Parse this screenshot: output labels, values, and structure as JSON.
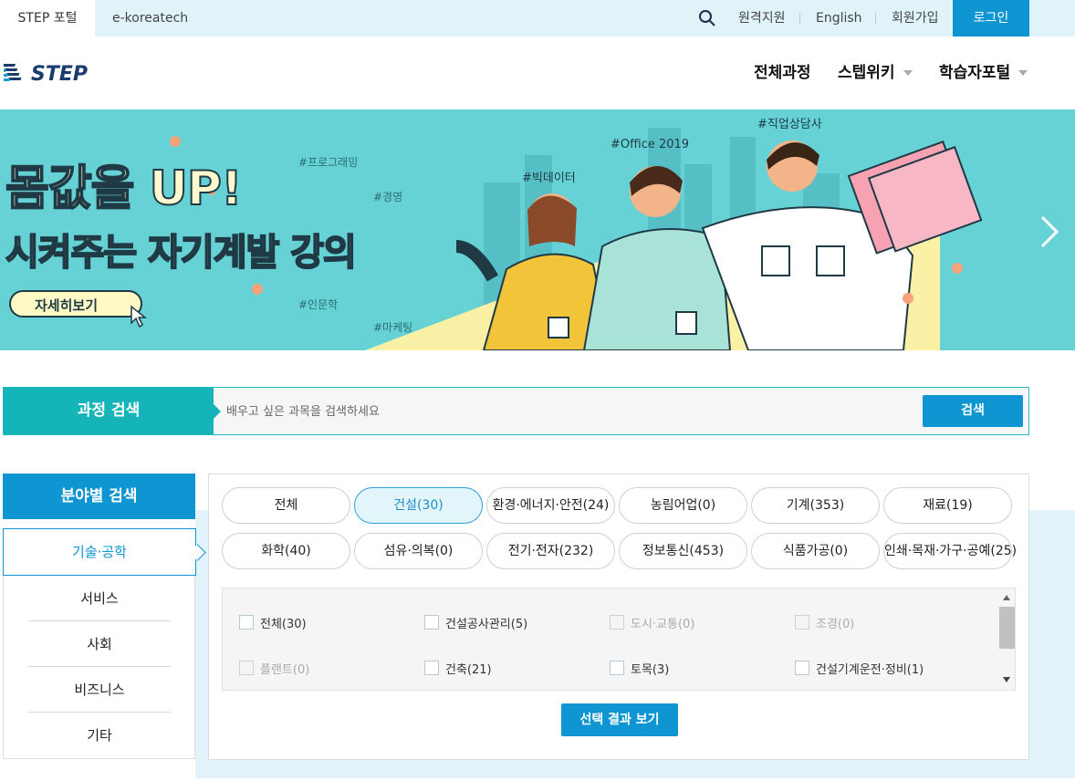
{
  "topbar": {
    "tabs": [
      "STEP 포털",
      "e-koreatech"
    ],
    "utils": [
      "원격지원",
      "English",
      "회원가입"
    ],
    "login": "로그인",
    "search_icon": "search-icon"
  },
  "header": {
    "logo_text": "STEP",
    "nav": [
      "전체과정",
      "스텝위키",
      "학습자포털"
    ]
  },
  "banner": {
    "title1": "몸값을 UP!",
    "title2": "시켜주는 자기계발 강의",
    "button": "자세히보기",
    "tags": [
      "#프로그래밍",
      "#경영",
      "#인문학",
      "#마케팅",
      "#빅데이터",
      "#Office 2019",
      "#직업상담사"
    ],
    "next_icon": "chevron-right-icon"
  },
  "course_search": {
    "label": "과정 검색",
    "placeholder": "배우고 싶은 과목을 검색하세요",
    "button": "검색"
  },
  "field_search": {
    "title": "분야별 검색",
    "categories": [
      "기술·공학",
      "서비스",
      "사회",
      "비즈니스",
      "기타"
    ],
    "active_category": "기술·공학",
    "chips": [
      "전체",
      "건설(30)",
      "환경·에너지·안전(24)",
      "농림어업(0)",
      "기계(353)",
      "재료(19)",
      "화학(40)",
      "섬유·의복(0)",
      "전기·전자(232)",
      "정보통신(453)",
      "식품가공(0)",
      "인쇄·목재·가구·공예(25)"
    ],
    "active_chip": "건설(30)",
    "subcategories": [
      {
        "label": "전체(30)",
        "disabled": false
      },
      {
        "label": "건설공사관리(5)",
        "disabled": false
      },
      {
        "label": "도시·교통(0)",
        "disabled": true
      },
      {
        "label": "조경(0)",
        "disabled": true
      },
      {
        "label": "플랜트(0)",
        "disabled": true
      },
      {
        "label": "건축(21)",
        "disabled": false
      },
      {
        "label": "토목(3)",
        "disabled": false
      },
      {
        "label": "건설기계운전·정비(1)",
        "disabled": false
      }
    ],
    "result_button": "선택 결과 보기"
  },
  "colors": {
    "primary": "#0e95d2",
    "teal": "#14b4b8",
    "banner_bg": "#67d2d6"
  }
}
